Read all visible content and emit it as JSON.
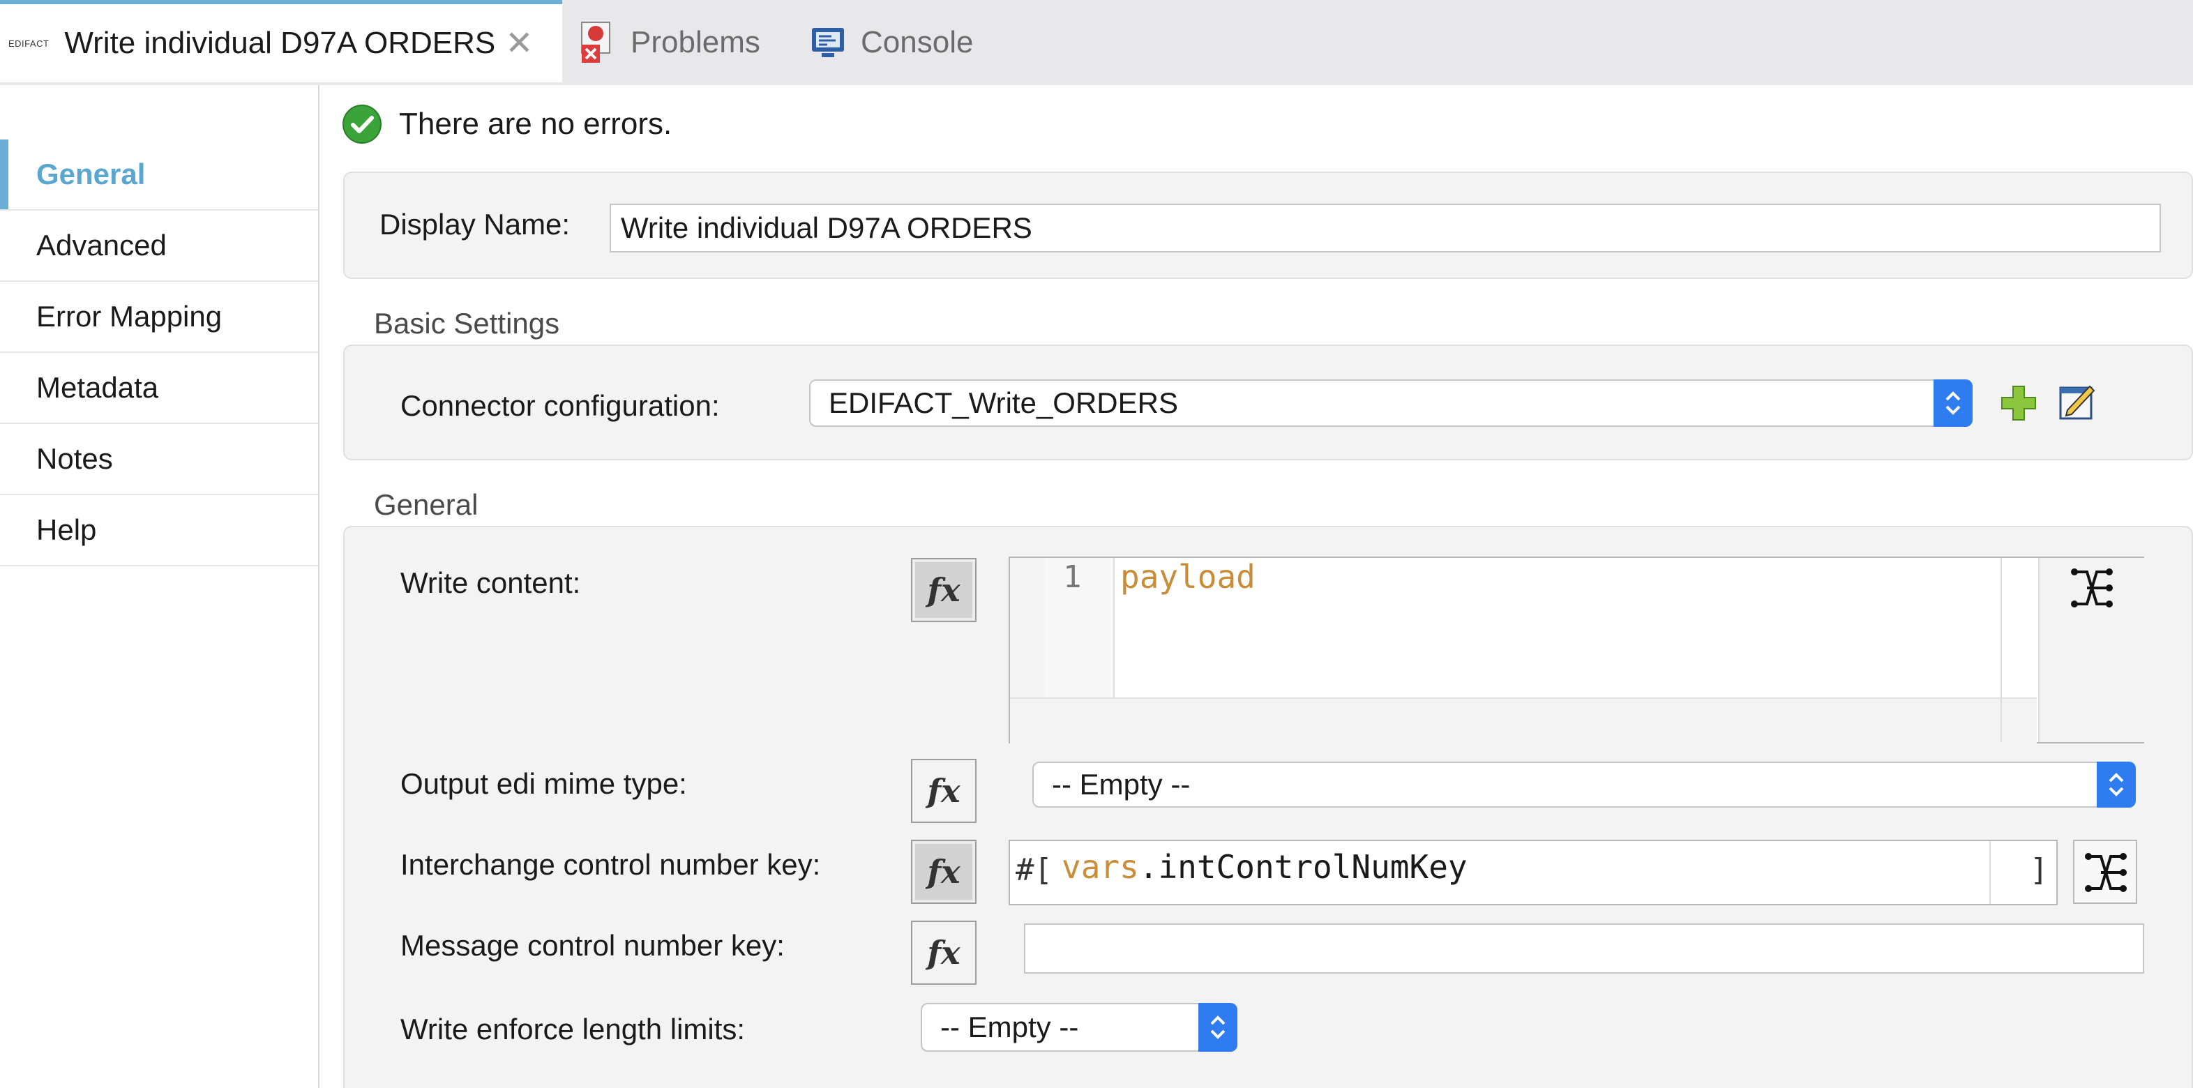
{
  "tabs": {
    "editor": {
      "icon_text": "EDIFACT",
      "label": "Write individual D97A ORDERS"
    },
    "problems": {
      "label": "Problems"
    },
    "console": {
      "label": "Console"
    }
  },
  "nav": {
    "items": [
      {
        "label": "General",
        "active": true
      },
      {
        "label": "Advanced"
      },
      {
        "label": "Error Mapping"
      },
      {
        "label": "Metadata"
      },
      {
        "label": "Notes"
      },
      {
        "label": "Help"
      }
    ]
  },
  "status": {
    "message": "There are no errors."
  },
  "display_name": {
    "label": "Display Name:",
    "value": "Write individual D97A ORDERS"
  },
  "basic_settings": {
    "title": "Basic Settings",
    "connector_label": "Connector configuration:",
    "connector_value": "EDIFACT_Write_ORDERS"
  },
  "general": {
    "title": "General",
    "write_content": {
      "label": "Write content:",
      "line_number": "1",
      "code": "payload"
    },
    "mime_type": {
      "label": "Output edi mime type:",
      "value": "-- Empty --"
    },
    "interchange_key": {
      "label": "Interchange control number key:",
      "prefix": "#[",
      "var": "vars",
      "rest": ".intControlNumKey",
      "suffix": "]"
    },
    "message_key": {
      "label": "Message control number key:",
      "value": ""
    },
    "enforce_limits": {
      "label": "Write enforce length limits:",
      "value": "-- Empty --"
    }
  },
  "icons": {
    "fx": "fx",
    "close": "close-icon",
    "add": "add-icon",
    "edit": "edit-icon",
    "mapping": "mapping-icon",
    "ok": "ok-icon"
  },
  "colors": {
    "accent": "#6aaed6",
    "select_arrow": "#2f7bf0",
    "code_keyword": "#c98d3a",
    "ok_green": "#3aa33a"
  }
}
